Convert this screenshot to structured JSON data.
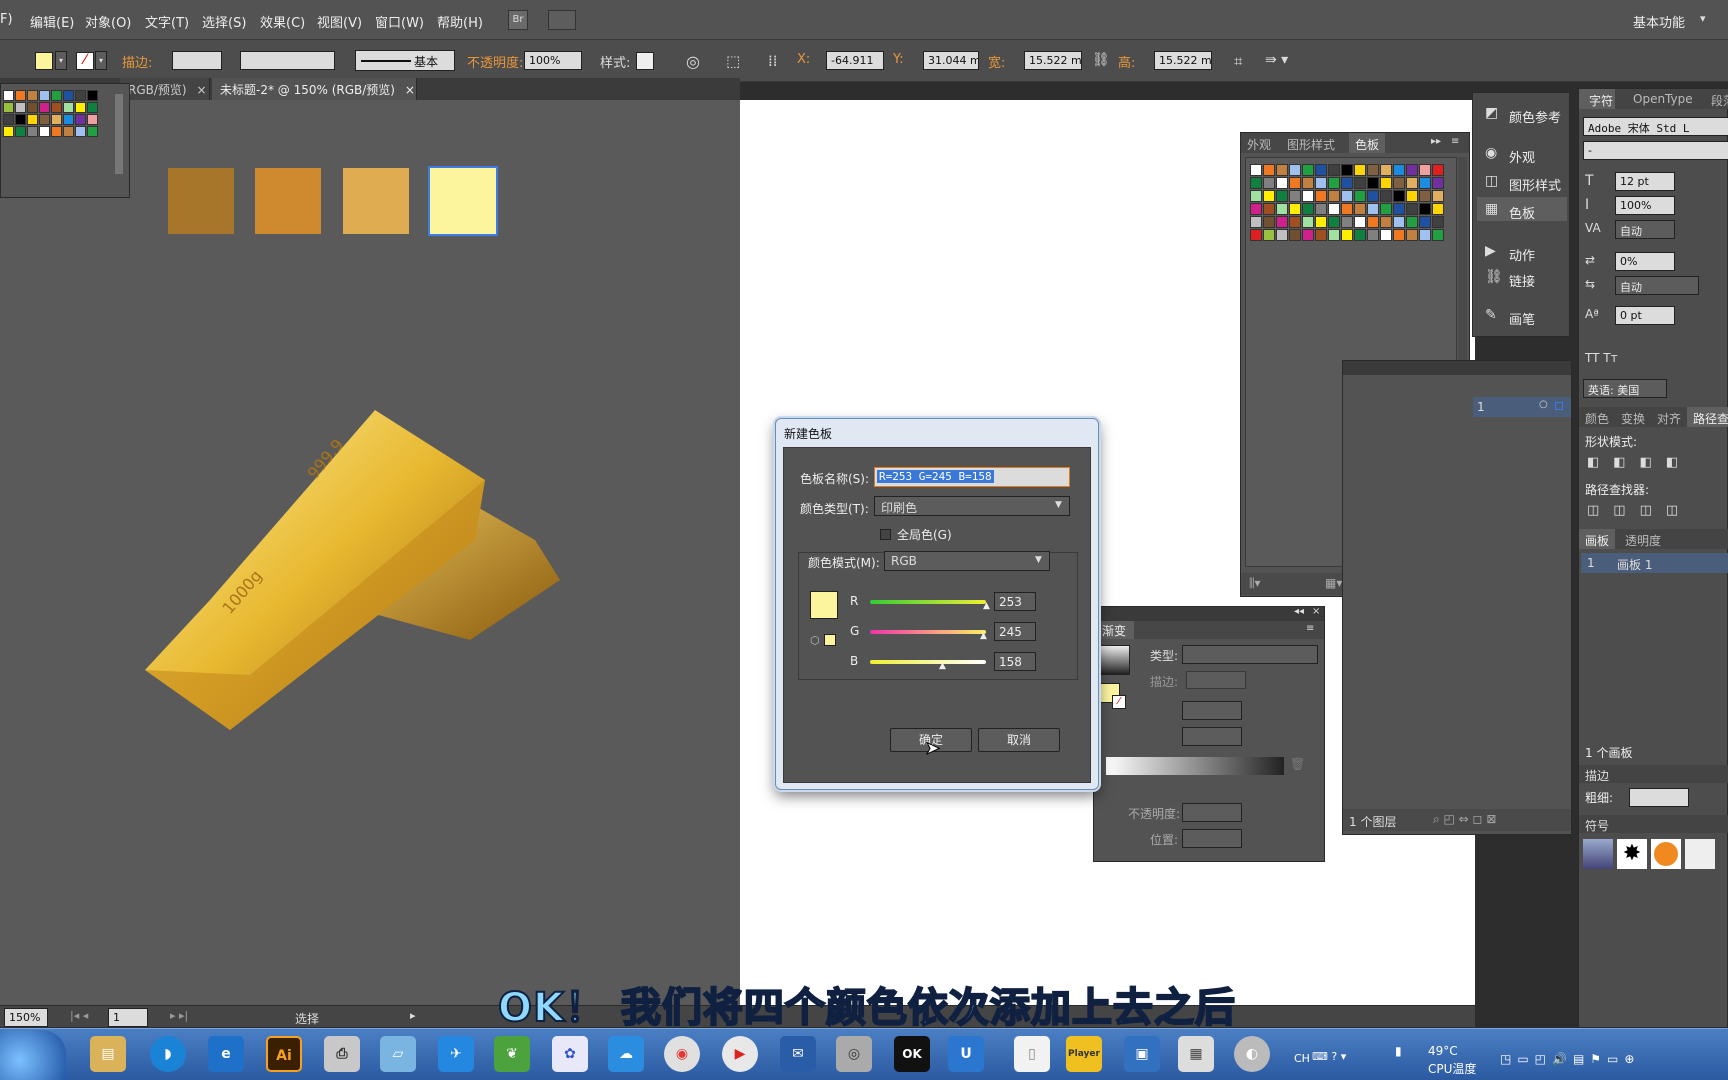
{
  "menu": {
    "items": [
      "F)",
      "编辑(E)",
      "对象(O)",
      "文字(T)",
      "选择(S)",
      "效果(C)",
      "视图(V)",
      "窗口(W)",
      "帮助(H)"
    ],
    "br_label": "Br",
    "workspace": "基本功能"
  },
  "control": {
    "stroke_label": "描边:",
    "stroke_style": "基本",
    "opacity_label": "不透明度:",
    "opacity_value": "100%",
    "style_label": "样式:",
    "x_label": "X:",
    "x_value": "-64.911",
    "y_label": "Y:",
    "y_value": "31.044 m",
    "w_label": "宽:",
    "w_value": "15.522 m",
    "h_label": "高:",
    "h_value": "15.522 m"
  },
  "tabs": [
    {
      "label": "RGB/预览)",
      "close": "×"
    },
    {
      "label": "未标题-2* @ 150% (RGB/预览)",
      "close": "×"
    }
  ],
  "canvas": {
    "squares": [
      "#a8762a",
      "#cf8a30",
      "#e0ac52",
      "#fdf59e"
    ],
    "gold_text_1": "999.9",
    "gold_text_2": "1000g"
  },
  "swatches_panel": {
    "tabs": [
      "外观",
      "图形样式",
      "色板"
    ],
    "active_tab": "色板"
  },
  "dialog": {
    "title": "新建色板",
    "name_label": "色板名称(S):",
    "name_value": "R=253 G=245 B=158",
    "type_label": "颜色类型(T):",
    "type_value": "印刷色",
    "global_label": "全局色(G)",
    "mode_label": "颜色模式(M):",
    "mode_value": "RGB",
    "color": "#fdf59e",
    "r_label": "R",
    "r_value": "253",
    "g_label": "G",
    "g_value": "245",
    "b_label": "B",
    "b_value": "158",
    "ok": "确定",
    "cancel": "取消"
  },
  "dock": {
    "items": [
      "颜色参考",
      "外观",
      "图形样式",
      "色板",
      "动作",
      "链接",
      "画笔"
    ]
  },
  "gradient_panel": {
    "title": "渐变",
    "type_label": "类型:",
    "stroke_label": "描边:",
    "opacity_label": "不透明度:",
    "position_label": "位置:"
  },
  "layers_panel": {
    "row_value": "1",
    "footer": "1 个图层"
  },
  "char_panel": {
    "tabs": [
      "字符",
      "OpenType",
      "段落"
    ],
    "font": "Adobe 宋体 Std L",
    "font_style": "-",
    "size": "12 pt",
    "leading": "100%",
    "kerning": "自动",
    "tracking": "0%",
    "auto2": "自动",
    "baseline": "0 pt",
    "language": "英语: 美国",
    "sub_tabs": [
      "颜色",
      "变换",
      "对齐",
      "路径查找器"
    ],
    "shape_modes": "形状模式:",
    "pathfinder": "路径查找器:",
    "artboard_tabs": [
      "画板",
      "透明度"
    ],
    "artboard_num": "1",
    "artboard_name": "画板 1",
    "artboard_count": "1 个画板",
    "stroke_title": "描边",
    "weight_label": "粗细:",
    "symbols_title": "符号"
  },
  "status": {
    "zoom": "150%",
    "page": "1",
    "tool": "选择"
  },
  "subtitle": "OK！ 我们将四个颜色依次添加上去之后",
  "taskbar": {
    "ai_label": "Ai",
    "temp": "49°C",
    "temp_label": "CPU温度",
    "lang": "CH",
    "player_label": "Player"
  }
}
